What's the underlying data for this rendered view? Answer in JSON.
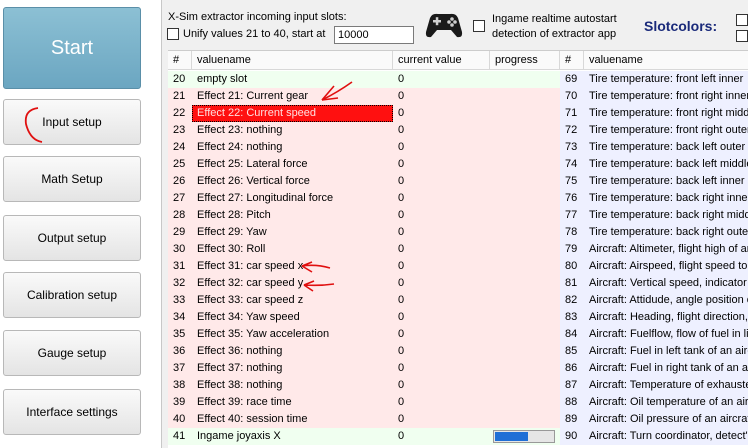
{
  "nav": {
    "start_label": "Start",
    "items": [
      {
        "label": "Input setup"
      },
      {
        "label": "Math Setup"
      },
      {
        "label": "Output setup"
      },
      {
        "label": "Calibration setup"
      },
      {
        "label": "Gauge setup"
      },
      {
        "label": "Interface settings"
      }
    ]
  },
  "header": {
    "title": "X-Sim extractor incoming input slots:",
    "unify_label": "Unify values 21 to 40, start at",
    "unify_checked": false,
    "start_value": "10000",
    "autostart_line1": "Ingame realtime autostart",
    "autostart_line2": "detection of extractor app",
    "slotcolors_label": "Slotcolors:",
    "gamepad_icon": "gamepad-icon"
  },
  "table": {
    "columns": {
      "num": "#",
      "valuename": "valuename",
      "current": "current value",
      "progress": "progress",
      "num2": "#",
      "valuename2": "valuename"
    },
    "colors": {
      "green": "#f0fff0",
      "pink": "#ffe9e9",
      "blue": "#eef0ff",
      "selected": "#ff1010",
      "progress": "#1f6fd6"
    },
    "left_rows": [
      {
        "num": "20",
        "name": "empty slot",
        "current": "0",
        "bg": "green"
      },
      {
        "num": "21",
        "name": "Effect 21: Current gear",
        "current": "0",
        "bg": "pink"
      },
      {
        "num": "22",
        "name": "Effect 22: Current speed",
        "current": "0",
        "bg": "pink",
        "selected": true
      },
      {
        "num": "23",
        "name": "Effect 23: nothing",
        "current": "0",
        "bg": "pink"
      },
      {
        "num": "24",
        "name": "Effect 24: nothing",
        "current": "0",
        "bg": "pink"
      },
      {
        "num": "25",
        "name": "Effect 25: Lateral force",
        "current": "0",
        "bg": "pink"
      },
      {
        "num": "26",
        "name": "Effect 26: Vertical force",
        "current": "0",
        "bg": "pink"
      },
      {
        "num": "27",
        "name": "Effect 27: Longitudinal force",
        "current": "0",
        "bg": "pink"
      },
      {
        "num": "28",
        "name": "Effect 28: Pitch",
        "current": "0",
        "bg": "pink"
      },
      {
        "num": "29",
        "name": "Effect 29: Yaw",
        "current": "0",
        "bg": "pink"
      },
      {
        "num": "30",
        "name": "Effect 30: Roll",
        "current": "0",
        "bg": "pink"
      },
      {
        "num": "31",
        "name": "Effect 31: car speed x",
        "current": "0",
        "bg": "pink"
      },
      {
        "num": "32",
        "name": "Effect 32: car speed y",
        "current": "0",
        "bg": "pink"
      },
      {
        "num": "33",
        "name": "Effect 33: car speed z",
        "current": "0",
        "bg": "pink"
      },
      {
        "num": "34",
        "name": "Effect 34: Yaw speed",
        "current": "0",
        "bg": "pink"
      },
      {
        "num": "35",
        "name": "Effect 35: Yaw acceleration",
        "current": "0",
        "bg": "pink"
      },
      {
        "num": "36",
        "name": "Effect 36: nothing",
        "current": "0",
        "bg": "pink"
      },
      {
        "num": "37",
        "name": "Effect 37: nothing",
        "current": "0",
        "bg": "pink"
      },
      {
        "num": "38",
        "name": "Effect 38: nothing",
        "current": "0",
        "bg": "pink"
      },
      {
        "num": "39",
        "name": "Effect 39: race time",
        "current": "0",
        "bg": "pink"
      },
      {
        "num": "40",
        "name": "Effect 40: session time",
        "current": "0",
        "bg": "pink"
      },
      {
        "num": "41",
        "name": "Ingame joyaxis X",
        "current": "0",
        "bg": "green",
        "progress": 0.55
      }
    ],
    "right_rows": [
      {
        "num": "69",
        "name": "Tire temperature: front left inner"
      },
      {
        "num": "70",
        "name": "Tire temperature: front right inner"
      },
      {
        "num": "71",
        "name": "Tire temperature: front right middle"
      },
      {
        "num": "72",
        "name": "Tire temperature: front right outer"
      },
      {
        "num": "73",
        "name": "Tire temperature: back left outer"
      },
      {
        "num": "74",
        "name": "Tire temperature: back left middle"
      },
      {
        "num": "75",
        "name": "Tire temperature: back left inner"
      },
      {
        "num": "76",
        "name": "Tire temperature: back right inner"
      },
      {
        "num": "77",
        "name": "Tire temperature: back right middle"
      },
      {
        "num": "78",
        "name": "Tire temperature: back right outer"
      },
      {
        "num": "79",
        "name": "Aircraft: Altimeter, flight high of an a"
      },
      {
        "num": "80",
        "name": "Aircraft: Airspeed, flight speed to air"
      },
      {
        "num": "81",
        "name": "Aircraft: Vertical speed, indicator fo"
      },
      {
        "num": "82",
        "name": "Aircraft: Attidude, angle position of"
      },
      {
        "num": "83",
        "name": "Aircraft: Heading, flight direction, c"
      },
      {
        "num": "84",
        "name": "Aircraft: Fuelflow, flow of fuel in lite"
      },
      {
        "num": "85",
        "name": "Aircraft: Fuel in left tank of an aircra"
      },
      {
        "num": "86",
        "name": "Aircraft: Fuel in right tank of an aircra"
      },
      {
        "num": "87",
        "name": "Aircraft: Temperature of exhausted"
      },
      {
        "num": "88",
        "name": "Aircraft: Oil temperature of an aircra"
      },
      {
        "num": "89",
        "name": "Aircraft: Oil pressure of an aircraft"
      },
      {
        "num": "90",
        "name": "Aircraft: Turn coordinator, detect's"
      }
    ]
  }
}
